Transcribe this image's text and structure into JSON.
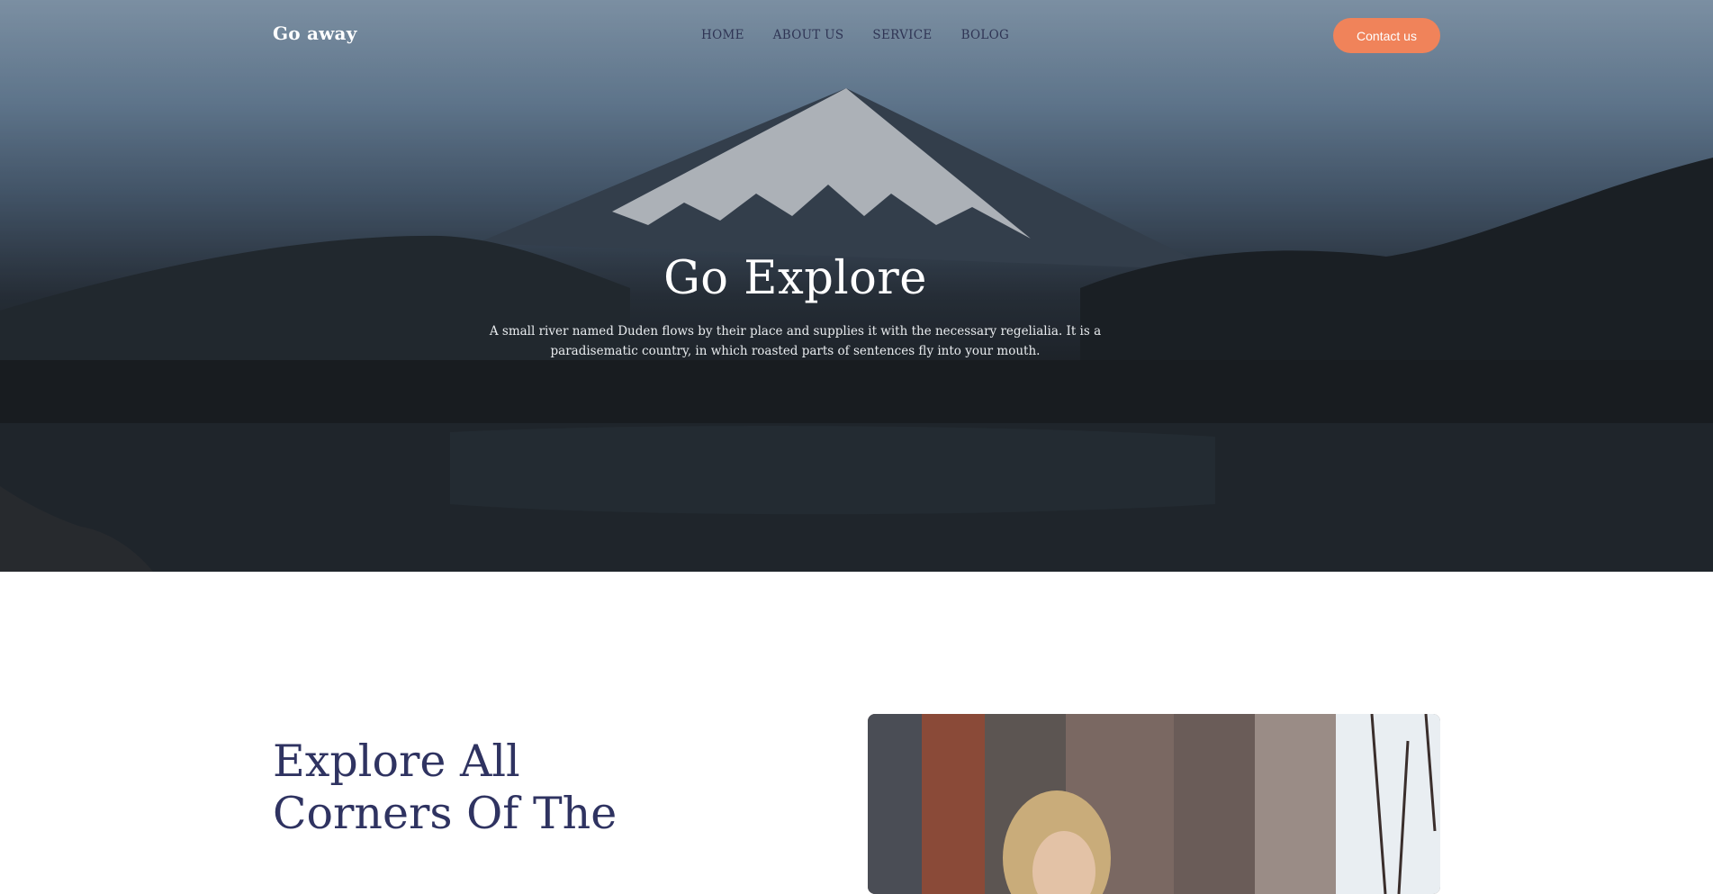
{
  "brand": {
    "name": "Go away"
  },
  "nav": {
    "items": [
      {
        "label": "HOME"
      },
      {
        "label": "ABOUT US"
      },
      {
        "label": "SERVICE"
      },
      {
        "label": "BOLOG"
      }
    ],
    "contact_label": "Contact us"
  },
  "hero": {
    "title": "Go Explore",
    "subtitle": "A small river named Duden flows by their place and supplies it with the necessary regelialia. It is a paradisematic country, in which roasted parts of sentences fly into your mouth."
  },
  "section": {
    "title": "Explore All Corners Of The"
  },
  "colors": {
    "accent": "#f0835a",
    "heading": "#2f3361",
    "nav_text": "#2f3454"
  }
}
